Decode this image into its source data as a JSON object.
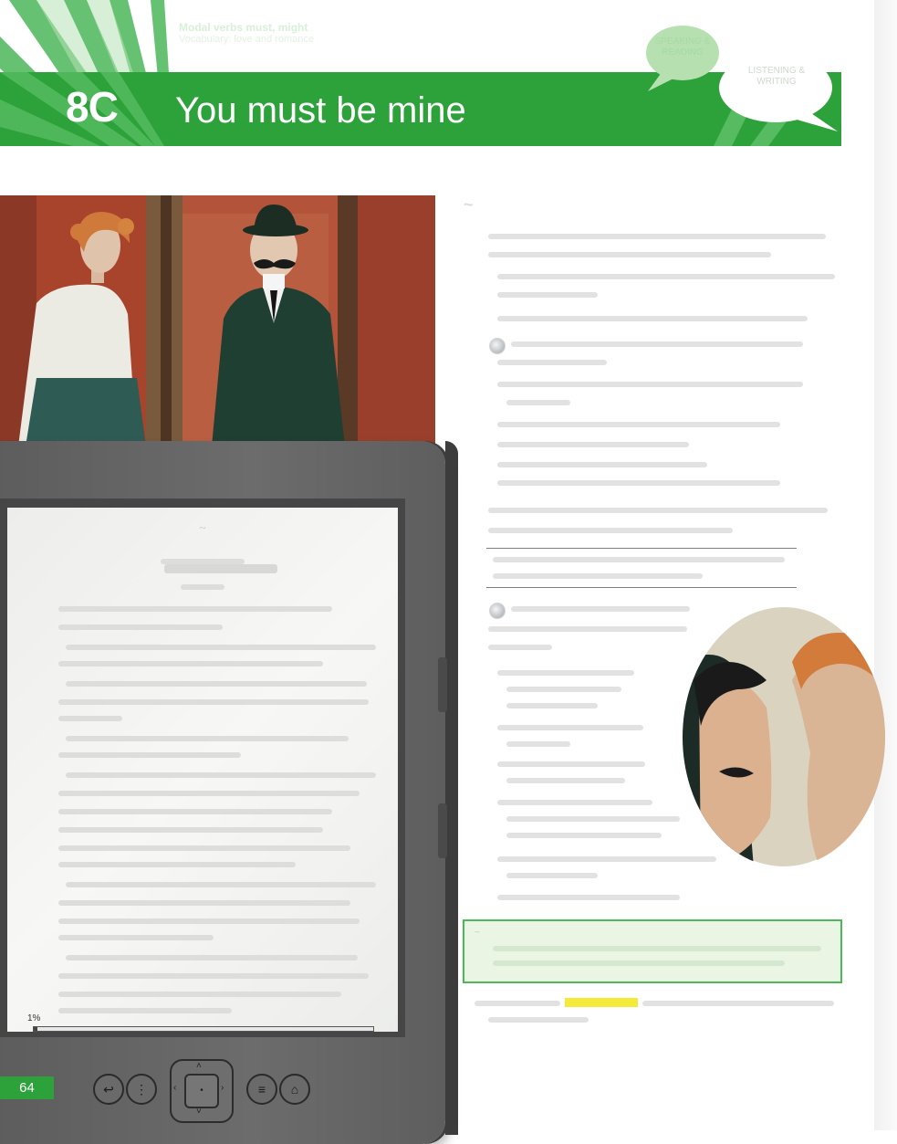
{
  "header": {
    "lesson_number": "8C",
    "lesson_title": "You must be mine",
    "grammar_topic": "Modal verbs must, might",
    "grammar_sub": "Vocabulary: love and romance",
    "bubble_green": "SPEAKING & READING",
    "bubble_white": "LISTENING & WRITING",
    "accent_color": "#2da23a"
  },
  "reader": {
    "progress_label": "1%",
    "progress_fraction": 0.01,
    "buttons": [
      "back-icon",
      "keyboard-icon",
      "menu-icon",
      "home-icon"
    ]
  },
  "footer": {
    "page_number": "64"
  },
  "colors": {
    "banner": "#2da23a",
    "note_border": "#4cb85a",
    "highlight": "#f4ea3a",
    "device_body": "#6a6a6a"
  }
}
